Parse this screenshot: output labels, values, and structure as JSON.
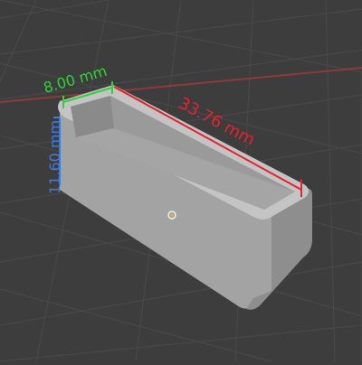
{
  "viewport": {
    "background": "#3d3d3d",
    "grid_color": "#4a4a4a",
    "x_axis_color": "#8b3b3b"
  },
  "object": {
    "name": "open-top rectangular box",
    "fill_side": "#a8a8a8",
    "fill_top": "#b5b5b5",
    "fill_inner": "#9c9c9c"
  },
  "dimensions": {
    "width": {
      "label": "8.00 mm",
      "color": "#31d13b"
    },
    "length": {
      "label": "33.76 mm",
      "color": "#e3242b"
    },
    "height": {
      "label": "11.60 mm",
      "color": "#3a7de0"
    }
  },
  "origin_marker": {
    "icon": "crosshair-origin-icon"
  }
}
